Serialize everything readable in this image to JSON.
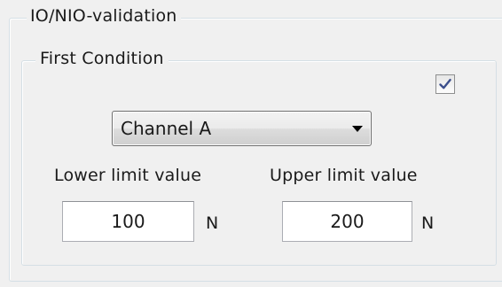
{
  "groups": {
    "outer_title": "IO/NIO-validation",
    "inner_title": "First Condition"
  },
  "condition": {
    "enabled": true,
    "channel": "Channel A"
  },
  "limits": {
    "lower_label": "Lower limit value",
    "lower_value": "100",
    "lower_unit": "N",
    "upper_label": "Upper limit value",
    "upper_value": "200",
    "upper_unit": "N"
  },
  "colors": {
    "panel_bg": "#f0f0f0",
    "group_border": "#d5dfe5",
    "check_mark": "#3c4f8c"
  },
  "icons": {
    "checkbox": "checkmark-icon",
    "combo": "chevron-down-icon"
  }
}
